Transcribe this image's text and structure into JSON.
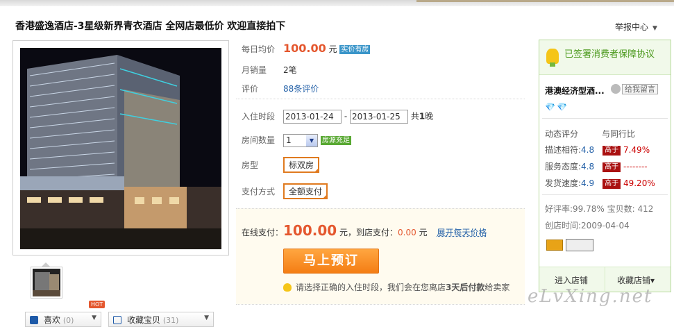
{
  "header": {
    "title": "香港盛逸酒店-3星级新界青衣酒店 全网店最低价 欢迎直接拍下",
    "report": "举报中心"
  },
  "colors": {
    "accent": "#e4572e",
    "link": "#2461a8",
    "green": "#4c9a1e",
    "button": "#f47d14"
  },
  "product": {
    "daily_label": "每日均价",
    "daily_price": "100.00",
    "daily_unit": "元",
    "daily_badge": "实价有房",
    "sales_label": "月销量",
    "sales_value": "2笔",
    "review_label": "评价",
    "review_value": "88条评价",
    "checkin_label": "入住时段",
    "checkin_date": "2013-01-24",
    "dash": "-",
    "checkout_date": "2013-01-25",
    "nights_pre": "共",
    "nights_num": "1",
    "nights_post": "晚",
    "rooms_label": "房间数量",
    "rooms_value": "1",
    "rooms_badge": "房源充足",
    "roomtype_label": "房型",
    "roomtype_value": "标双房",
    "pay_label": "支付方式",
    "pay_value": "全额支付",
    "online_label": "在线支付：",
    "online_price": "100.00",
    "online_unit": "元，到店支付：",
    "store_price": "0.00",
    "store_unit": "元",
    "expand": "展开每天价格",
    "book_button": "马上预订",
    "tip_pre": "请选择正确的入住时段，我们会在您离店",
    "tip_bold": "3天后付款",
    "tip_post": "给卖家"
  },
  "gallery": {
    "hot": "HOT",
    "like_label": "喜欢",
    "like_count": "(0)",
    "collect_label": "收藏宝贝",
    "collect_count": "(31)"
  },
  "seller": {
    "guarantee": "已签署消费者保障协议",
    "shop": "港澳经济型酒...",
    "message": "给我留言",
    "diamonds": "💎💎",
    "rating_title": "动态评分",
    "compare_title": "与同行比",
    "ratings": [
      {
        "label": "描述相符:",
        "score": "4.8",
        "tag": "高于",
        "pct": "7.49%"
      },
      {
        "label": "服务态度:",
        "score": "4.8",
        "tag": "高于",
        "pct": "--------"
      },
      {
        "label": "发货速度:",
        "score": "4.9",
        "tag": "高于",
        "pct": "49.20%"
      }
    ],
    "good_rate": "好评率:99.78% 宝贝数: 412",
    "created": "创店时间:2009-04-04",
    "enter_shop": "进入店铺",
    "collect_shop": "收藏店铺",
    "collect_caret": "▾"
  },
  "watermark": "eLvXing.net"
}
